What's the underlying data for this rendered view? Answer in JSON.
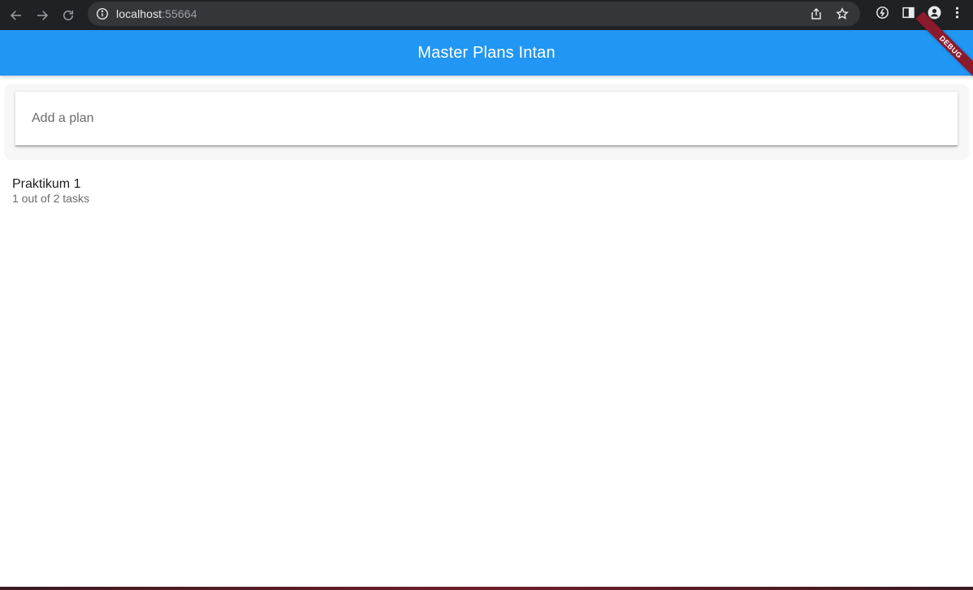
{
  "browser": {
    "url_host": "localhost",
    "url_port": ":55664",
    "icons": [
      "back-icon",
      "forward-icon",
      "reload-icon",
      "info-icon",
      "share-icon",
      "star-icon",
      "extension-icon",
      "side-panel-icon",
      "profile-icon",
      "menu-icon"
    ]
  },
  "app_bar": {
    "title": "Master Plans Intan",
    "color": "#2196f3"
  },
  "debug_banner": {
    "label": "DEBUG",
    "color": "#8b1a2d"
  },
  "input": {
    "placeholder": "Add a plan",
    "value": ""
  },
  "plans": [
    {
      "name": "Praktikum 1",
      "progress": "1 out of 2 tasks"
    }
  ]
}
